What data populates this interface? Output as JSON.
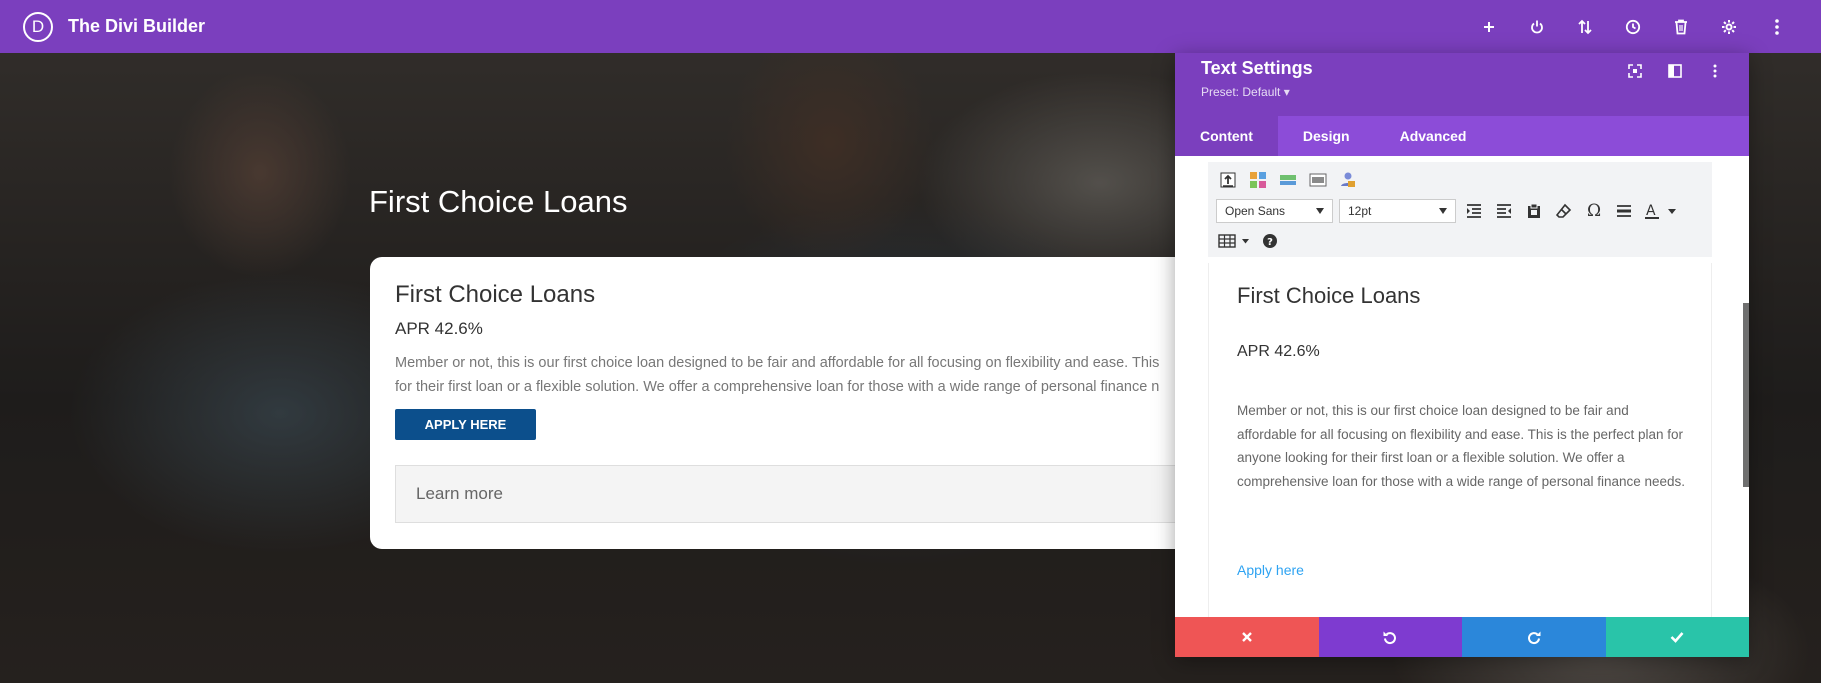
{
  "app": {
    "title": "The Divi Builder",
    "logo_letter": "D"
  },
  "topbar": {
    "icons": [
      "plus-icon",
      "power-icon",
      "sort-icon",
      "history-icon",
      "trash-icon",
      "gear-icon",
      "more-icon"
    ]
  },
  "hero": {
    "title": "First Choice Loans"
  },
  "card": {
    "title": "First Choice Loans",
    "apr": "APR 42.6%",
    "desc_line1": "Member or not, this is our first choice loan designed to be fair and affordable for all focusing on flexibility and ease. This",
    "desc_line2": "for their first loan or a flexible solution. We offer a comprehensive loan for those with a wide range of personal finance n",
    "button": "APPLY HERE",
    "learn_more": "Learn more"
  },
  "modal": {
    "title": "Text Settings",
    "preset": "Preset: Default ▾",
    "tabs": [
      "Content",
      "Design",
      "Advanced"
    ],
    "toolbar": {
      "font": "Open Sans",
      "size": "12pt"
    },
    "editor": {
      "title": "First Choice Loans",
      "apr": "APR 42.6%",
      "desc": "Member or not, this is our first choice loan designed to be fair and affordable for all focusing on flexibility and ease. This is the perfect plan for anyone looking for their first loan or a flexible solution. We offer a comprehensive loan for those with a wide range of personal finance needs.",
      "link": "Apply here"
    },
    "footer": {
      "colors": {
        "cancel": "#ef5555",
        "undo": "#7e3bd0",
        "redo": "#2b87da",
        "save": "#29c4a9"
      }
    }
  }
}
